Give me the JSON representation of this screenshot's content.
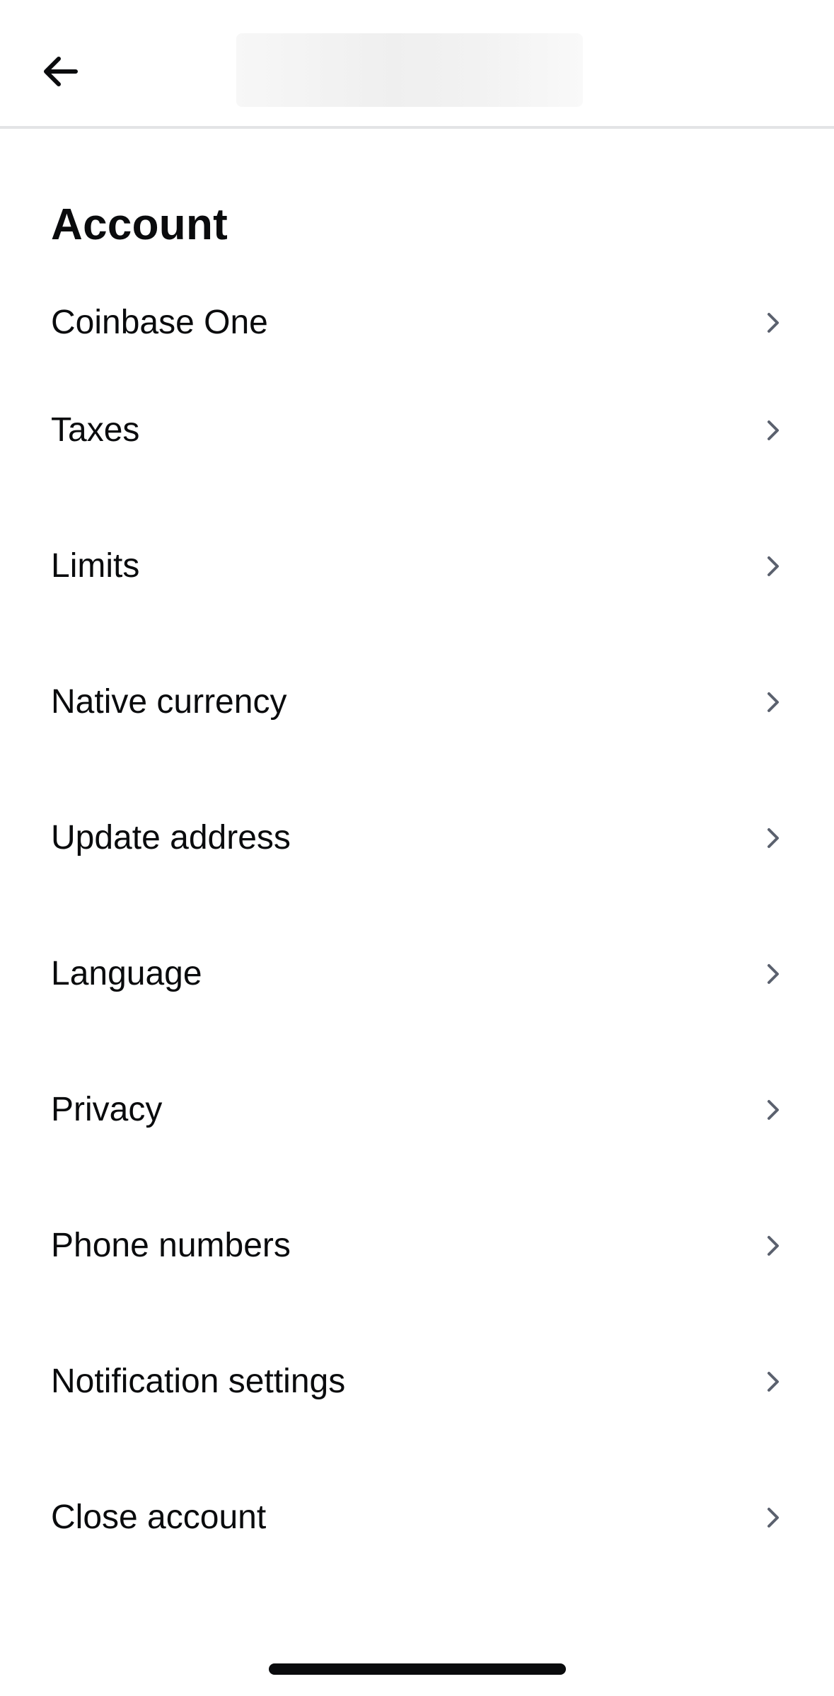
{
  "header": {
    "back_icon": "arrow-left-icon"
  },
  "section": {
    "title": "Account"
  },
  "menu": {
    "items": [
      {
        "label": "Coinbase One",
        "icon": "chevron-right-icon"
      },
      {
        "label": "Taxes",
        "icon": "chevron-right-icon"
      },
      {
        "label": "Limits",
        "icon": "chevron-right-icon"
      },
      {
        "label": "Native currency",
        "icon": "chevron-right-icon"
      },
      {
        "label": "Update address",
        "icon": "chevron-right-icon"
      },
      {
        "label": "Language",
        "icon": "chevron-right-icon"
      },
      {
        "label": "Privacy",
        "icon": "chevron-right-icon"
      },
      {
        "label": "Phone numbers",
        "icon": "chevron-right-icon"
      },
      {
        "label": "Notification settings",
        "icon": "chevron-right-icon"
      },
      {
        "label": "Close account",
        "icon": "chevron-right-icon"
      }
    ]
  },
  "colors": {
    "text": "#0a0b0d",
    "chevron": "#5b616e",
    "divider": "#e3e4e6",
    "background": "#ffffff"
  }
}
